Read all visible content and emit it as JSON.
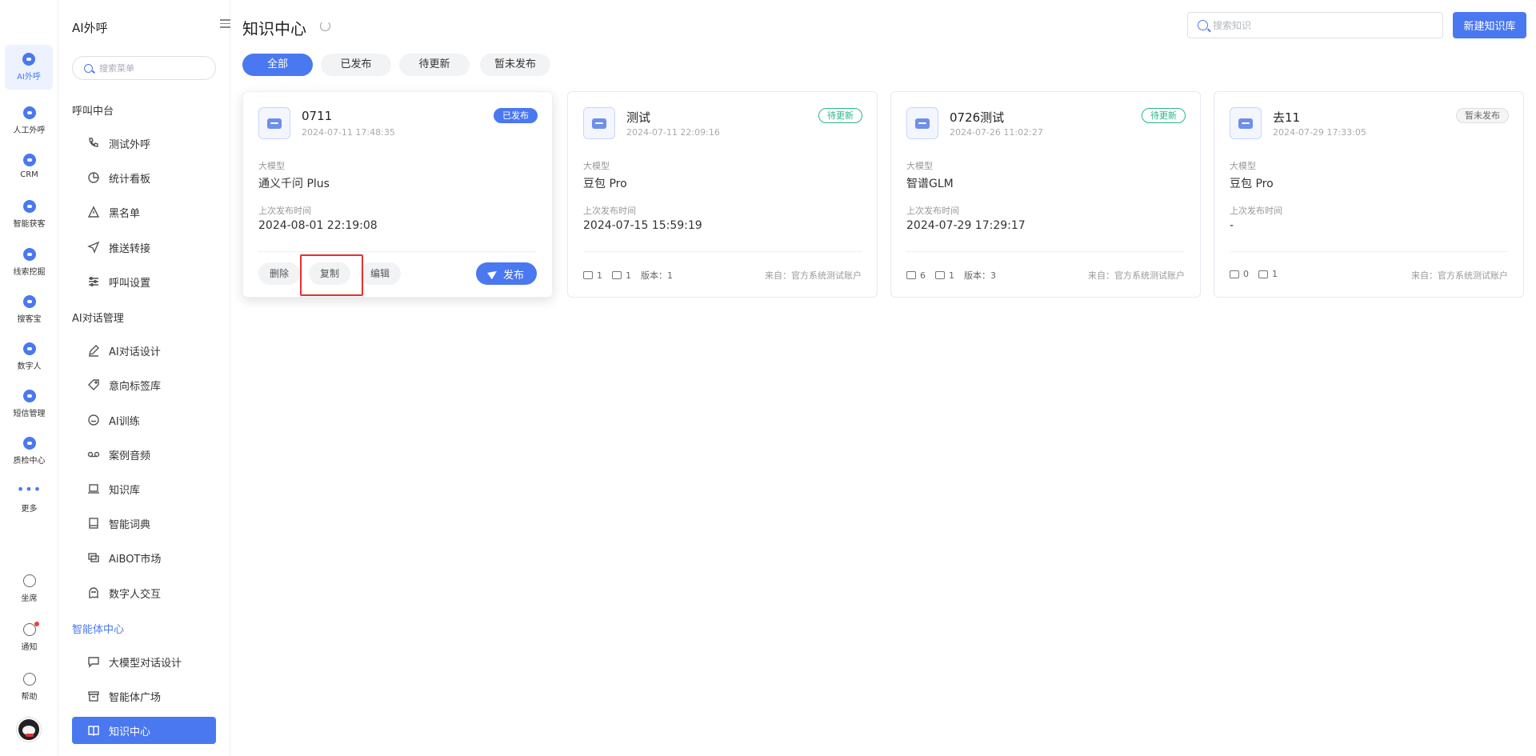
{
  "rail": {
    "items": [
      {
        "label": "AI外呼",
        "icon": "phone-robot-icon"
      },
      {
        "label": "人工外呼",
        "icon": "headset-icon"
      },
      {
        "label": "CRM",
        "icon": "crm-icon"
      },
      {
        "label": "智能获客",
        "icon": "magnet-icon"
      },
      {
        "label": "线索挖掘",
        "icon": "document-icon"
      },
      {
        "label": "搜客宝",
        "icon": "phone-icon"
      },
      {
        "label": "数字人",
        "icon": "video-icon"
      },
      {
        "label": "短信管理",
        "icon": "message-icon"
      },
      {
        "label": "质检中心",
        "icon": "shield-icon"
      },
      {
        "label": "更多",
        "icon": "more-dots-icon"
      }
    ],
    "bottom": [
      {
        "label": "坐席",
        "icon": "headphone-icon"
      },
      {
        "label": "通知",
        "icon": "bell-icon"
      },
      {
        "label": "帮助",
        "icon": "help-icon"
      }
    ]
  },
  "menu": {
    "title": "AI外呼",
    "search_placeholder": "搜索菜单",
    "groups": [
      {
        "title": "呼叫中台",
        "items": [
          {
            "label": "测试外呼",
            "icon": "phone-icon"
          },
          {
            "label": "统计看板",
            "icon": "pie-chart-icon"
          },
          {
            "label": "黑名单",
            "icon": "warning-icon"
          },
          {
            "label": "推送转接",
            "icon": "send-icon"
          },
          {
            "label": "呼叫设置",
            "icon": "sliders-icon"
          }
        ]
      },
      {
        "title": "AI对话管理",
        "items": [
          {
            "label": "AI对话设计",
            "icon": "edit-icon"
          },
          {
            "label": "意向标签库",
            "icon": "tag-icon"
          },
          {
            "label": "AI训练",
            "icon": "chat-bubble-icon"
          },
          {
            "label": "案例音频",
            "icon": "voicemail-icon"
          },
          {
            "label": "知识库",
            "icon": "laptop-icon"
          },
          {
            "label": "智能词典",
            "icon": "book-icon"
          },
          {
            "label": "AiBOT市场",
            "icon": "screens-icon"
          },
          {
            "label": "数字人交互",
            "icon": "ghost-icon"
          }
        ]
      },
      {
        "title": "智能体中心",
        "items": [
          {
            "label": "大模型对话设计",
            "icon": "message-square-icon"
          },
          {
            "label": "智能体广场",
            "icon": "archive-icon"
          },
          {
            "label": "知识中心",
            "icon": "open-book-icon"
          }
        ]
      }
    ]
  },
  "header": {
    "title": "知识中心",
    "search_placeholder": "搜索知识",
    "new_button": "新建知识库"
  },
  "filters": [
    "全部",
    "已发布",
    "待更新",
    "暂未发布"
  ],
  "labels": {
    "model": "大模型",
    "last_publish": "上次发布时间",
    "delete": "删除",
    "copy": "复制",
    "edit": "编辑",
    "publish": "发布"
  },
  "cards": [
    {
      "name": "0711",
      "date": "2024-07-11 17:48:35",
      "status": "已发布",
      "model": "通义千问 Plus",
      "last_publish": "2024-08-01 22:19:08"
    },
    {
      "name": "测试",
      "date": "2024-07-11 22:09:16",
      "status": "待更新",
      "model": "豆包 Pro",
      "last_publish": "2024-07-15 15:59:19",
      "chat_count": "1",
      "folder_count": "1",
      "version": "版本：1",
      "source": "来自：官方系统测试账户"
    },
    {
      "name": "0726测试",
      "date": "2024-07-26 11:02:27",
      "status": "待更新",
      "model": "智谱GLM",
      "last_publish": "2024-07-29 17:29:17",
      "chat_count": "6",
      "folder_count": "1",
      "version": "版本：3",
      "source": "来自：官方系统测试账户"
    },
    {
      "name": "去11",
      "date": "2024-07-29 17:33:05",
      "status": "暂未发布",
      "model": "豆包 Pro",
      "last_publish": "-",
      "chat_count": "0",
      "folder_count": "1",
      "source": "来自：官方系统测试账户"
    }
  ],
  "colors": {
    "accent": "#4a78f0",
    "update": "#2bb58a",
    "highlight": "#e53030"
  }
}
